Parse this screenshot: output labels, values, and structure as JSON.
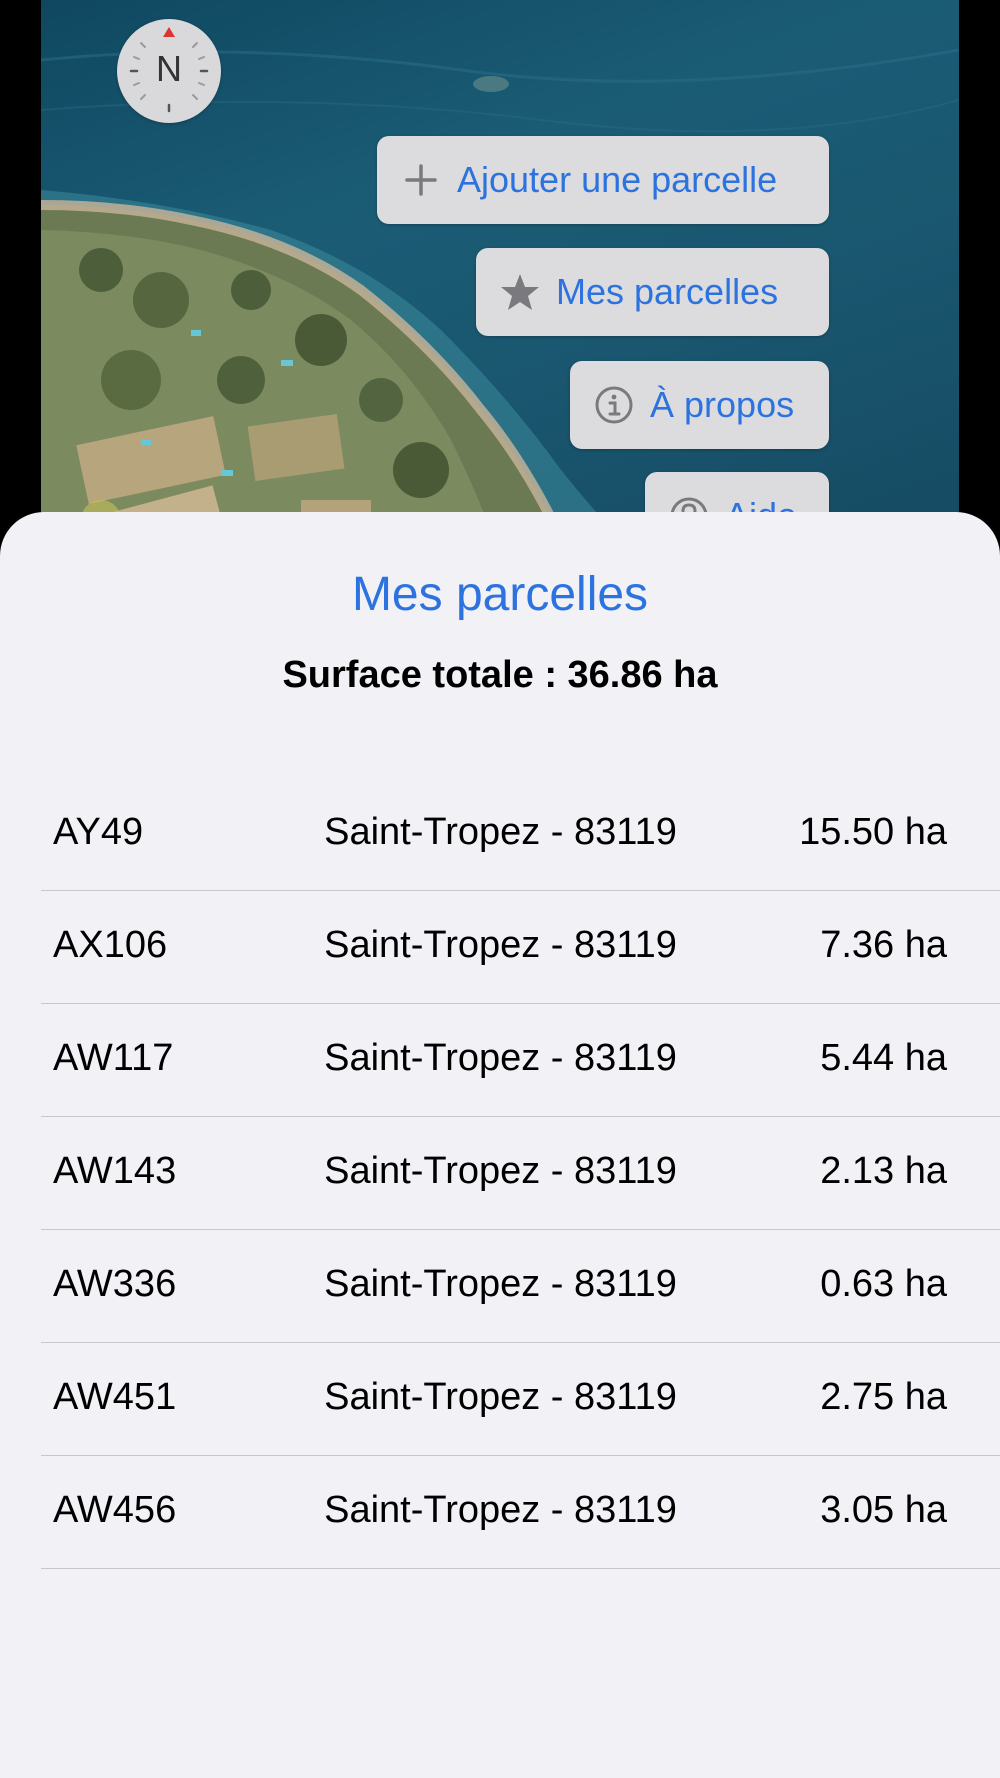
{
  "map": {
    "compass_label": "N",
    "buttons": {
      "add_parcel": {
        "label": "Ajouter une parcelle",
        "icon": "plus-icon"
      },
      "my_parcels": {
        "label": "Mes parcelles",
        "icon": "star-icon"
      },
      "about": {
        "label": "À propos",
        "icon": "info-icon"
      },
      "help": {
        "label": "Aide",
        "icon": "question-icon"
      }
    }
  },
  "sheet": {
    "title": "Mes parcelles",
    "total_area": "Surface totale : 36.86 ha",
    "parcels": [
      {
        "id": "AY49",
        "commune": "Saint-Tropez - 83119",
        "area": "15.50 ha"
      },
      {
        "id": "AX106",
        "commune": "Saint-Tropez - 83119",
        "area": "7.36 ha"
      },
      {
        "id": "AW117",
        "commune": "Saint-Tropez - 83119",
        "area": "5.44 ha"
      },
      {
        "id": "AW143",
        "commune": "Saint-Tropez - 83119",
        "area": "2.13 ha"
      },
      {
        "id": "AW336",
        "commune": "Saint-Tropez - 83119",
        "area": "0.63 ha"
      },
      {
        "id": "AW451",
        "commune": "Saint-Tropez - 83119",
        "area": "2.75 ha"
      },
      {
        "id": "AW456",
        "commune": "Saint-Tropez - 83119",
        "area": "3.05 ha"
      }
    ]
  },
  "colors": {
    "accent": "#2c73e0",
    "sheet_background": "#f1f1f6",
    "button_background": "#dcdcde",
    "separator": "#c8c8cc"
  }
}
